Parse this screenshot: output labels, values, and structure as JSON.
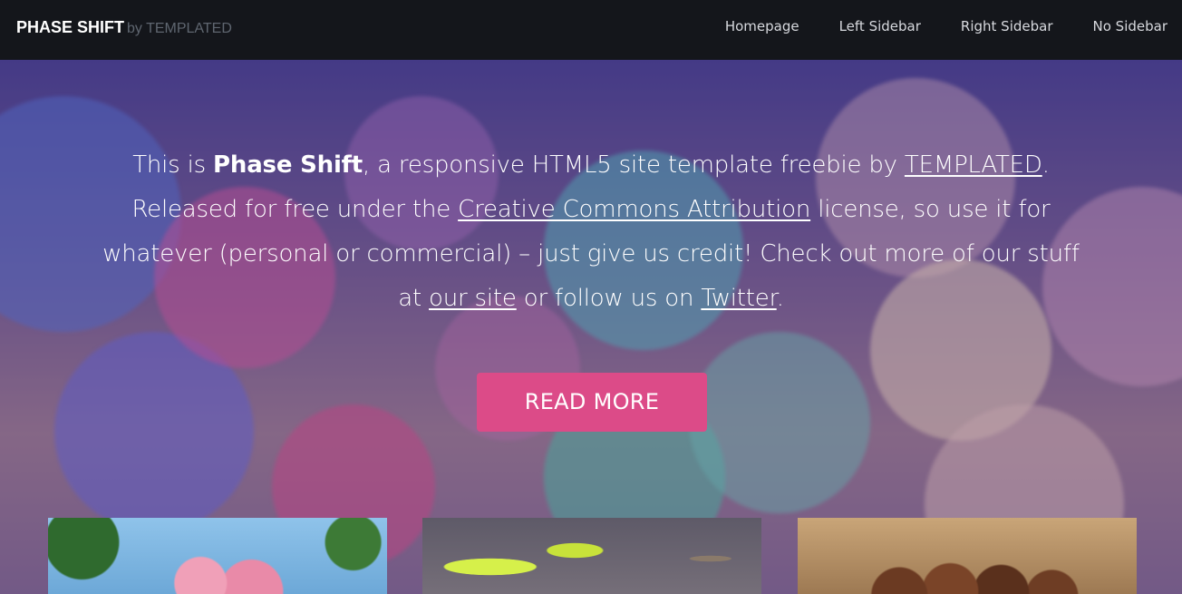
{
  "header": {
    "logo_main": "PHASE SHIFT",
    "logo_by": "by TEMPLATED",
    "nav": [
      "Homepage",
      "Left Sidebar",
      "Right Sidebar",
      "No Sidebar"
    ]
  },
  "hero": {
    "line1_pre": "This is ",
    "line1_bold": "Phase Shift",
    "line1_mid": ", a responsive HTML5 site template freebie by ",
    "link_templated": "TEMPLATED",
    "line1_end": ".",
    "line2_pre": "Released for free under the ",
    "link_cc": "Creative Commons Attribution",
    "line2_post": " license, so use it for",
    "line3": "whatever (personal or commercial) – just give us credit! Check out more of our stuff",
    "line4_pre": "at ",
    "link_site": "our site",
    "line4_mid": " or follow us on ",
    "link_twitter": "Twitter",
    "line4_end": ".",
    "cta_label": "READ MORE"
  },
  "thumbnails": [
    "flower-image",
    "leaf-image",
    "nuts-image"
  ],
  "colors": {
    "topbar": "#14161b",
    "accent": "#dc4b88",
    "text": "#ffffff"
  }
}
